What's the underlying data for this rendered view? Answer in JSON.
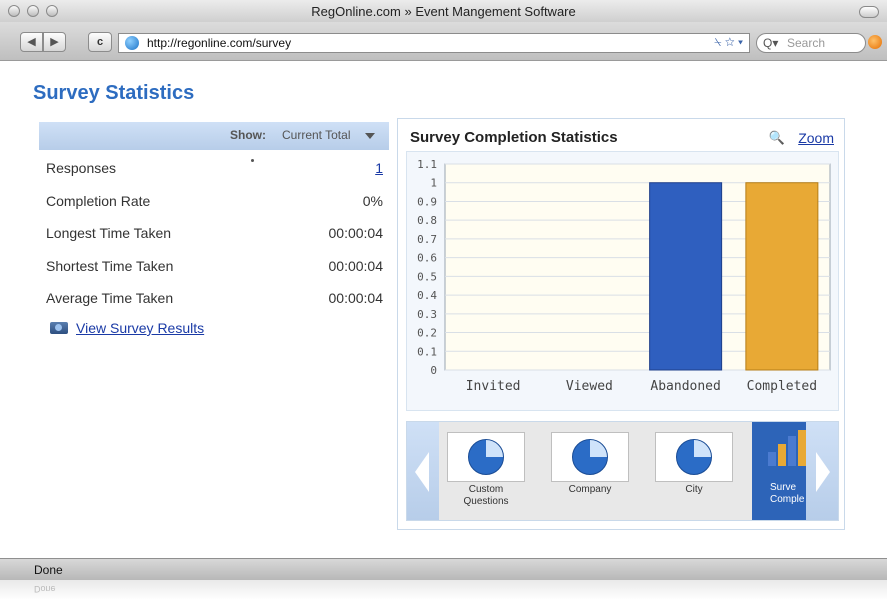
{
  "window": {
    "title": "RegOnline.com » Event Mangement Software"
  },
  "toolbar": {
    "back_icon": "◀",
    "forward_icon": "▶",
    "reload_icon": "c",
    "url": "http://regonline.com/survey",
    "url_icons": "⍀ ☆ ▾",
    "search_placeholder": "Search",
    "search_prefix": "Q▾"
  },
  "page": {
    "title": "Survey Statistics"
  },
  "stats": {
    "show_label": "Show:",
    "show_value": "Current Total",
    "rows": [
      {
        "label": "Responses",
        "value": "1"
      },
      {
        "label": "Completion Rate",
        "value": "0%"
      },
      {
        "label": "Longest Time Taken",
        "value": "00:00:04"
      },
      {
        "label": "Shortest Time Taken",
        "value": "00:00:04"
      },
      {
        "label": "Average Time Taken",
        "value": "00:00:04"
      }
    ],
    "view_results": "View Survey Results"
  },
  "chart_panel": {
    "title": "Survey Completion Statistics",
    "zoom_label": "Zoom"
  },
  "chart_data": {
    "type": "bar",
    "title": "Survey Completion Statistics",
    "categories": [
      "Invited",
      "Viewed",
      "Abandoned",
      "Completed"
    ],
    "values": [
      0,
      0,
      1,
      1
    ],
    "colors": [
      "#2f5fbf",
      "#2f5fbf",
      "#2f5fbf",
      "#e8a935"
    ],
    "ylim": [
      0,
      1.1
    ],
    "yticks": [
      "0",
      "0.1",
      "0.2",
      "0.3",
      "0.4",
      "0.5",
      "0.6",
      "0.7",
      "0.8",
      "0.9",
      "1",
      "1.1"
    ],
    "grid": true
  },
  "carousel": {
    "items": [
      {
        "label": "Custom Questions"
      },
      {
        "label": "Company"
      },
      {
        "label": "City"
      },
      {
        "label": "Surve Comple"
      }
    ]
  },
  "status": {
    "text": "Done",
    "reflection": "Done"
  },
  "colors": {
    "accent": "#2d6cc0",
    "link": "#1a3aa6",
    "bar_blue": "#2f5fbf",
    "bar_orange": "#e8a935"
  }
}
